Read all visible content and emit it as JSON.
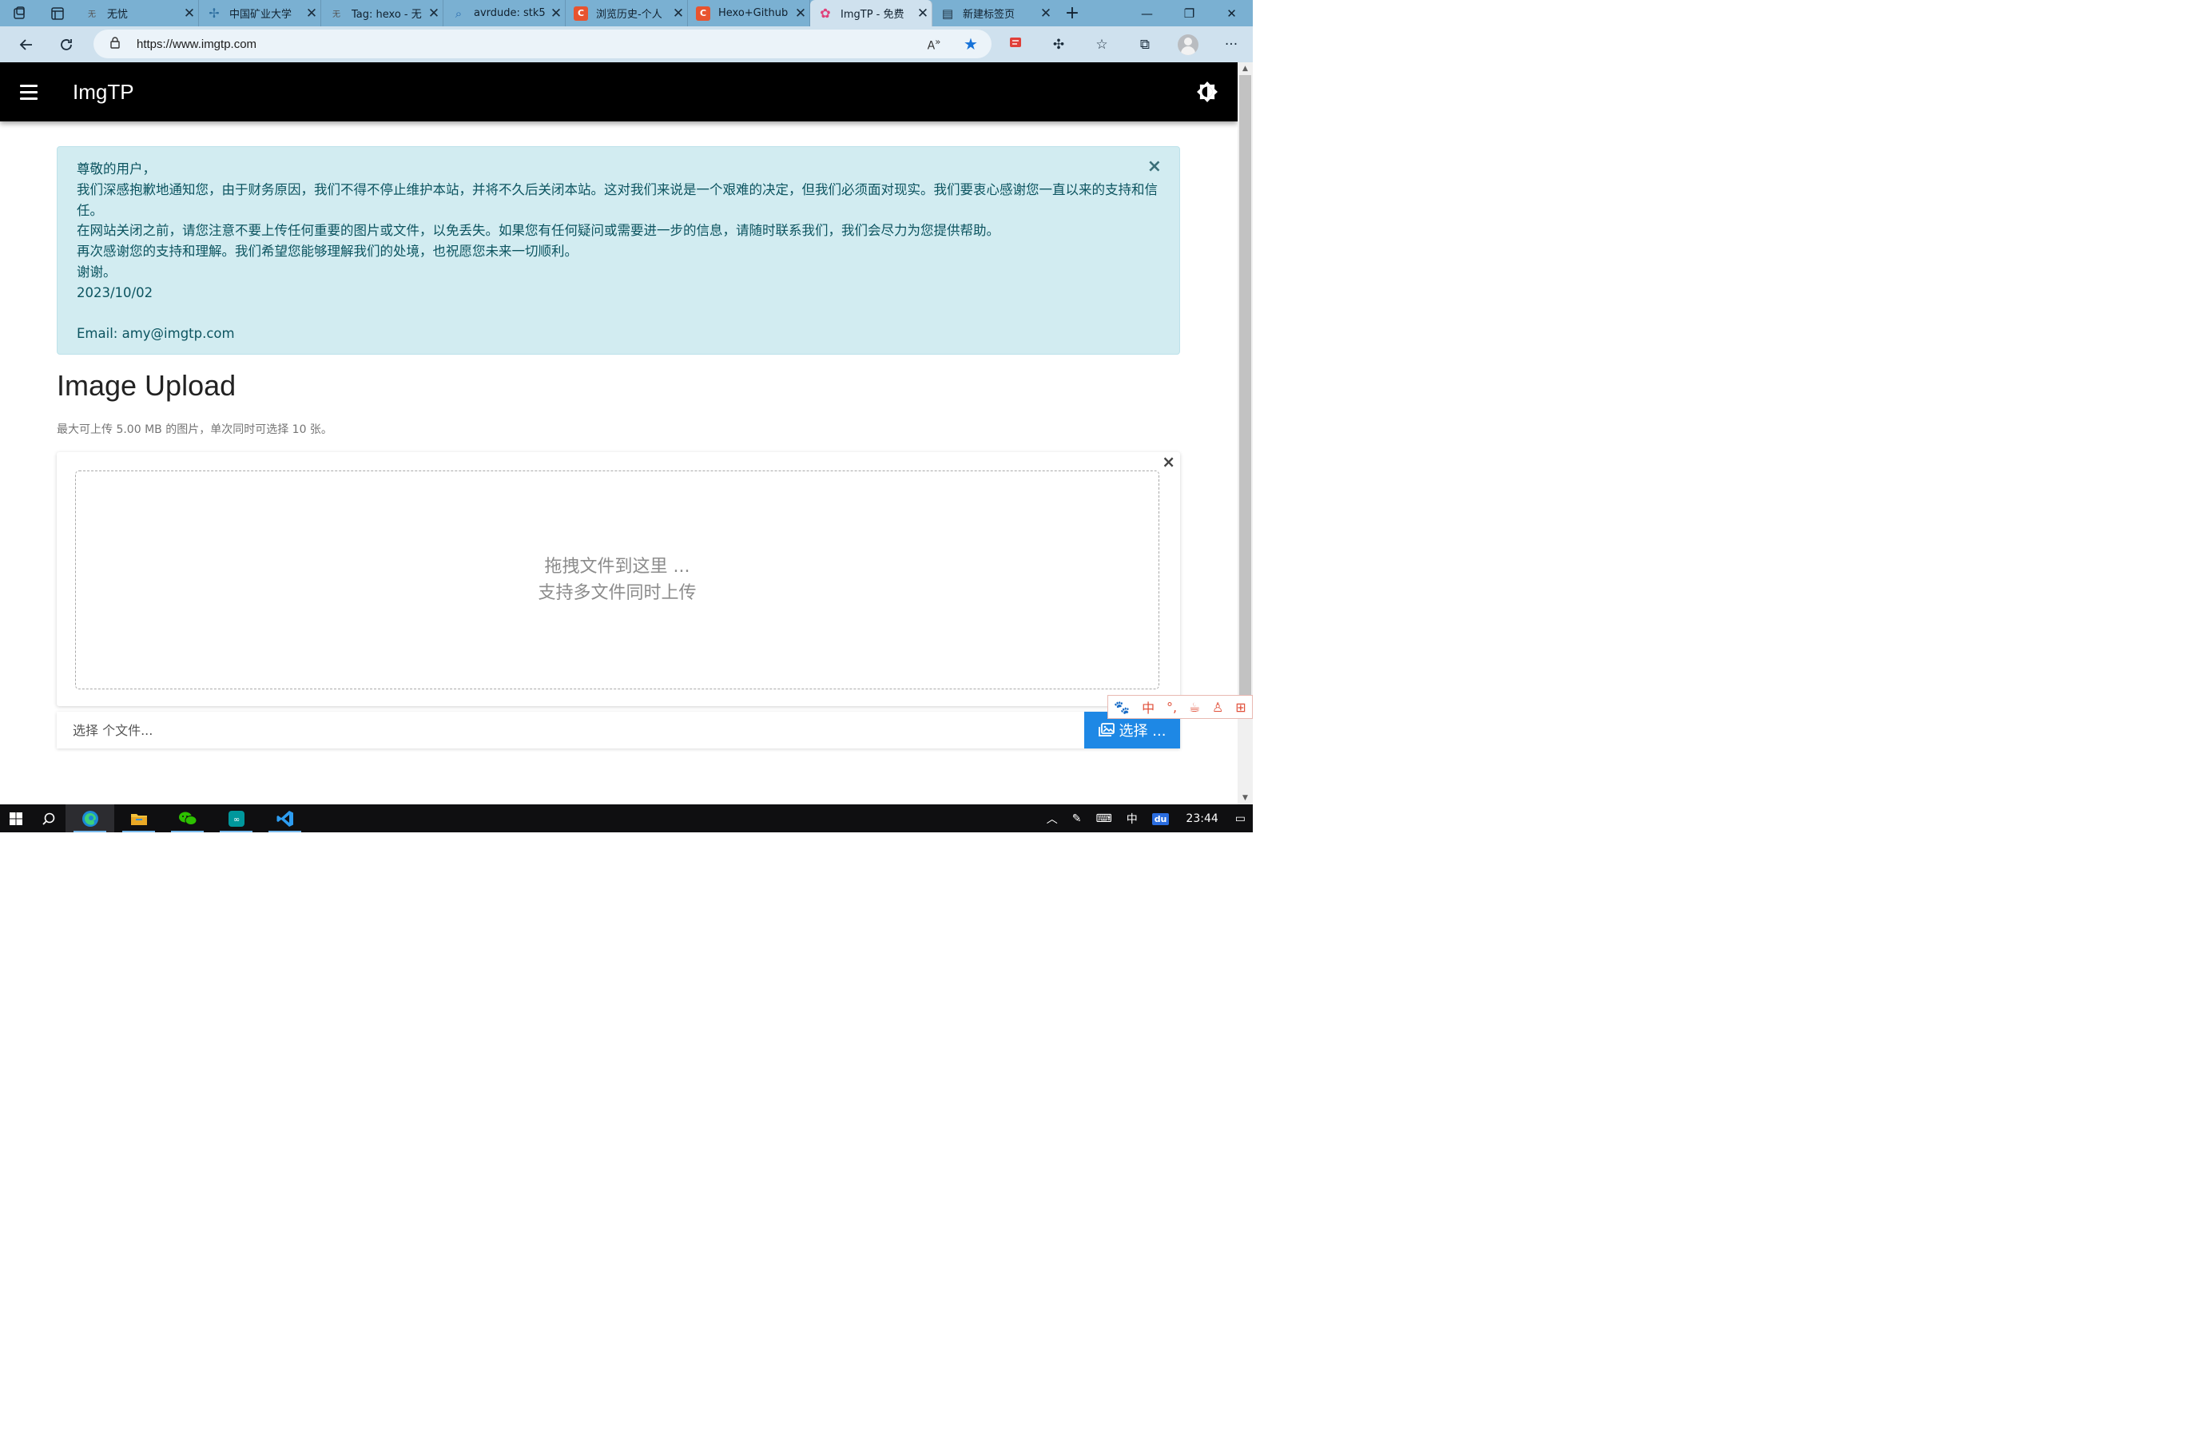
{
  "browser": {
    "tabs": [
      {
        "favicon": "无",
        "title": "无忧",
        "active": false
      },
      {
        "favicon": "✢",
        "title": "中国矿业大学",
        "active": false
      },
      {
        "favicon": "无",
        "title": "Tag: hexo - 无",
        "active": false
      },
      {
        "favicon": "⌕",
        "title": "avrdude: stk5",
        "active": false
      },
      {
        "favicon": "C",
        "title": "浏览历史-个人",
        "active": false
      },
      {
        "favicon": "C",
        "title": "Hexo+Github",
        "active": false
      },
      {
        "favicon": "✿",
        "title": "ImgTP - 免费",
        "active": true
      },
      {
        "favicon": "▤",
        "title": "新建标签页",
        "active": false
      }
    ],
    "url": "https://www.imgtp.com"
  },
  "site": {
    "brand": "ImgTP"
  },
  "notice": {
    "lines": [
      "尊敬的用户，",
      "我们深感抱歉地通知您，由于财务原因，我们不得不停止维护本站，并将不久后关闭本站。这对我们来说是一个艰难的决定，但我们必须面对现实。我们要衷心感谢您一直以来的支持和信任。",
      "在网站关闭之前，请您注意不要上传任何重要的图片或文件，以免丢失。如果您有任何疑问或需要进一步的信息，请随时联系我们，我们会尽力为您提供帮助。",
      "再次感谢您的支持和理解。我们希望您能够理解我们的处境，也祝愿您未来一切顺利。",
      "谢谢。",
      "2023/10/02"
    ],
    "email": "Email: amy@imgtp.com",
    "close": "×"
  },
  "upload": {
    "title": "Image Upload",
    "hint": "最大可上传 5.00 MB 的图片，单次同时可选择 10 张。",
    "drop_line1": "拖拽文件到这里 ...",
    "drop_line2": "支持多文件同时上传",
    "close": "×",
    "file_placeholder": "选择 个文件...",
    "choose_label": "选择 ..."
  },
  "ime": {
    "items": [
      "🐾",
      "中",
      "°,",
      "☕",
      "♙",
      "⊞"
    ]
  },
  "taskbar": {
    "ime_indicator": "中",
    "baidu_label": "du",
    "time": "23:44"
  },
  "colors": {
    "navbar": "#000000",
    "alert_bg": "#d2ecf1",
    "alert_text": "#0c5460",
    "button": "#1e88e5",
    "tabstrip": "#7ab0d2"
  }
}
